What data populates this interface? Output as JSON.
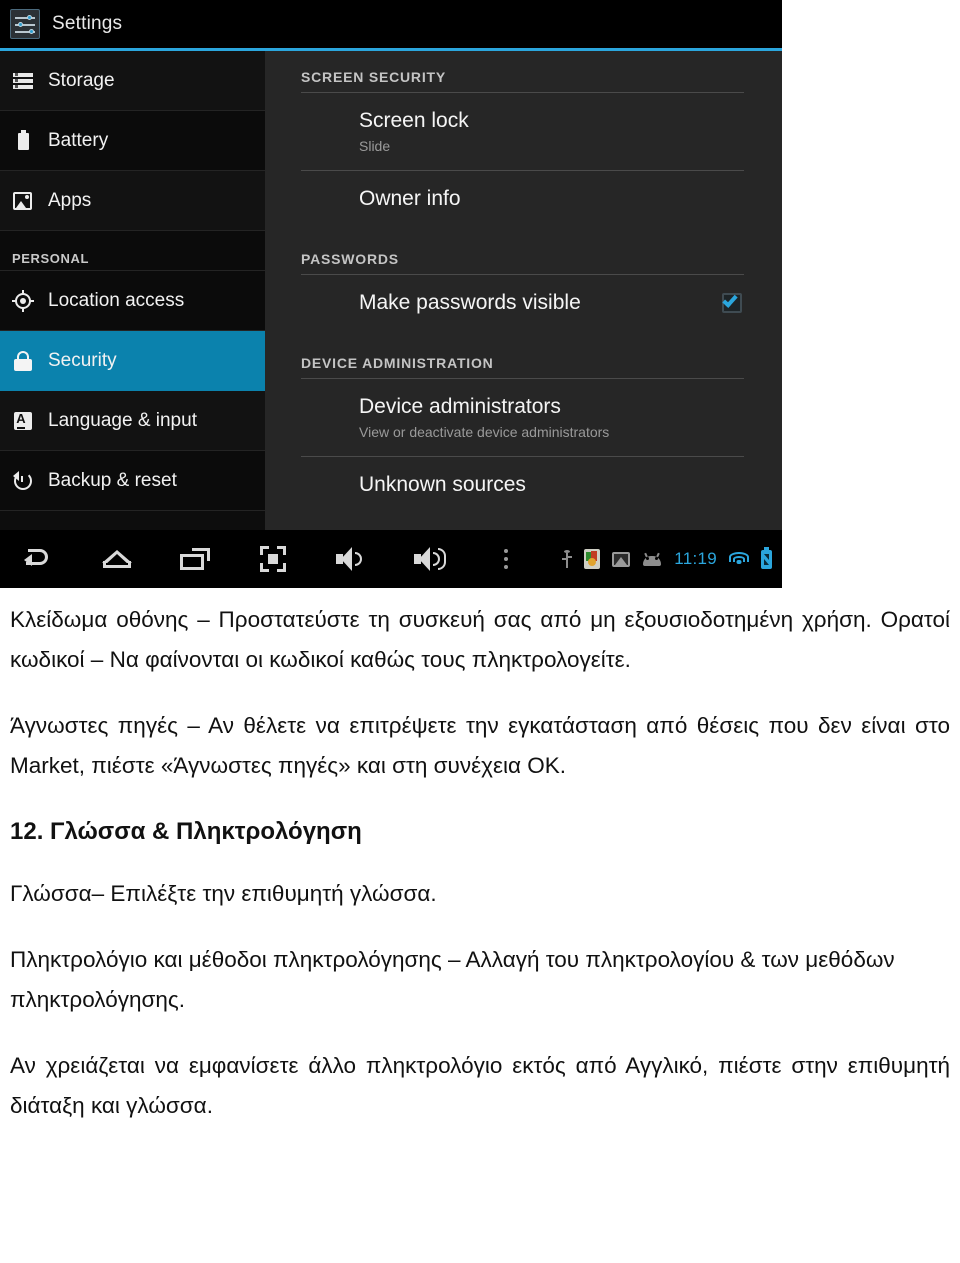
{
  "screenshot": {
    "action_bar": {
      "app_icon": "settings-sliders-icon",
      "title": "Settings"
    },
    "accent_color": "#2ba6dd",
    "sidebar": {
      "items": [
        {
          "label": "Storage",
          "icon": "storage-icon",
          "type": "item",
          "selected": false
        },
        {
          "label": "Battery",
          "icon": "battery-icon",
          "type": "item",
          "selected": false
        },
        {
          "label": "Apps",
          "icon": "apps-icon",
          "type": "item",
          "selected": false
        },
        {
          "label": "PERSONAL",
          "icon": "",
          "type": "header",
          "selected": false
        },
        {
          "label": "Location access",
          "icon": "location-icon",
          "type": "item",
          "selected": false
        },
        {
          "label": "Security",
          "icon": "lock-icon",
          "type": "item",
          "selected": true
        },
        {
          "label": "Language & input",
          "icon": "language-icon",
          "type": "item",
          "selected": false
        },
        {
          "label": "Backup & reset",
          "icon": "backup-reset-icon",
          "type": "item",
          "selected": false
        }
      ]
    },
    "content": {
      "section_1_header": "SCREEN SECURITY",
      "pref_screen_lock_title": "Screen lock",
      "pref_screen_lock_summary": "Slide",
      "pref_owner_info_title": "Owner info",
      "section_2_header": "PASSWORDS",
      "pref_make_passwords_visible_title": "Make passwords visible",
      "pref_make_passwords_visible_checked": "true",
      "section_3_header": "DEVICE ADMINISTRATION",
      "pref_device_admins_title": "Device administrators",
      "pref_device_admins_summary": "View or deactivate device administrators",
      "pref_unknown_sources_title": "Unknown sources"
    },
    "navbar": {
      "back": "back-icon",
      "home": "home-icon",
      "recents": "recent-apps-icon",
      "screenshot": "screenshot-icon",
      "volume_down": "volume-down-icon",
      "volume_up": "volume-up-icon",
      "overflow": "overflow-menu-icon"
    },
    "status_tray": {
      "usb": "usb-icon",
      "sd_card": "sd-card-icon",
      "screenshot_capture": "image-icon",
      "android": "android-icon",
      "clock": "11:19",
      "wifi": "wifi-icon",
      "battery": "battery-charging-icon"
    }
  },
  "document": {
    "paragraph_1": "Κλείδωμα οθόνης – Προστατεύστε τη συσκευή σας από μη εξουσιοδοτημένη χρήση. Ορατοί κωδικοί – Να φαίνονται οι κωδικοί καθώς τους πληκτρολογείτε.",
    "paragraph_2": "Άγνωστες πηγές – Αν θέλετε να επιτρέψετε την εγκατάσταση από θέσεις που δεν είναι στο Market, πιέστε «Άγνωστες πηγές» και στη συνέχεια ΟΚ.",
    "heading_12": "12. Γλώσσα & Πληκτρολόγηση",
    "paragraph_3": "Γλώσσα– Επιλέξτε την επιθυμητή γλώσσα.",
    "paragraph_4": "Πληκτρολόγιο και μέθοδοι πληκτρολόγησης – Αλλαγή του πληκτρολογίου & των μεθόδων πληκτρολόγησης.",
    "paragraph_5": "Αν χρειάζεται να εμφανίσετε άλλο πληκτρολόγιο εκτός από Αγγλικό, πιέστε στην επιθυμητή διάταξη και γλώσσα."
  }
}
